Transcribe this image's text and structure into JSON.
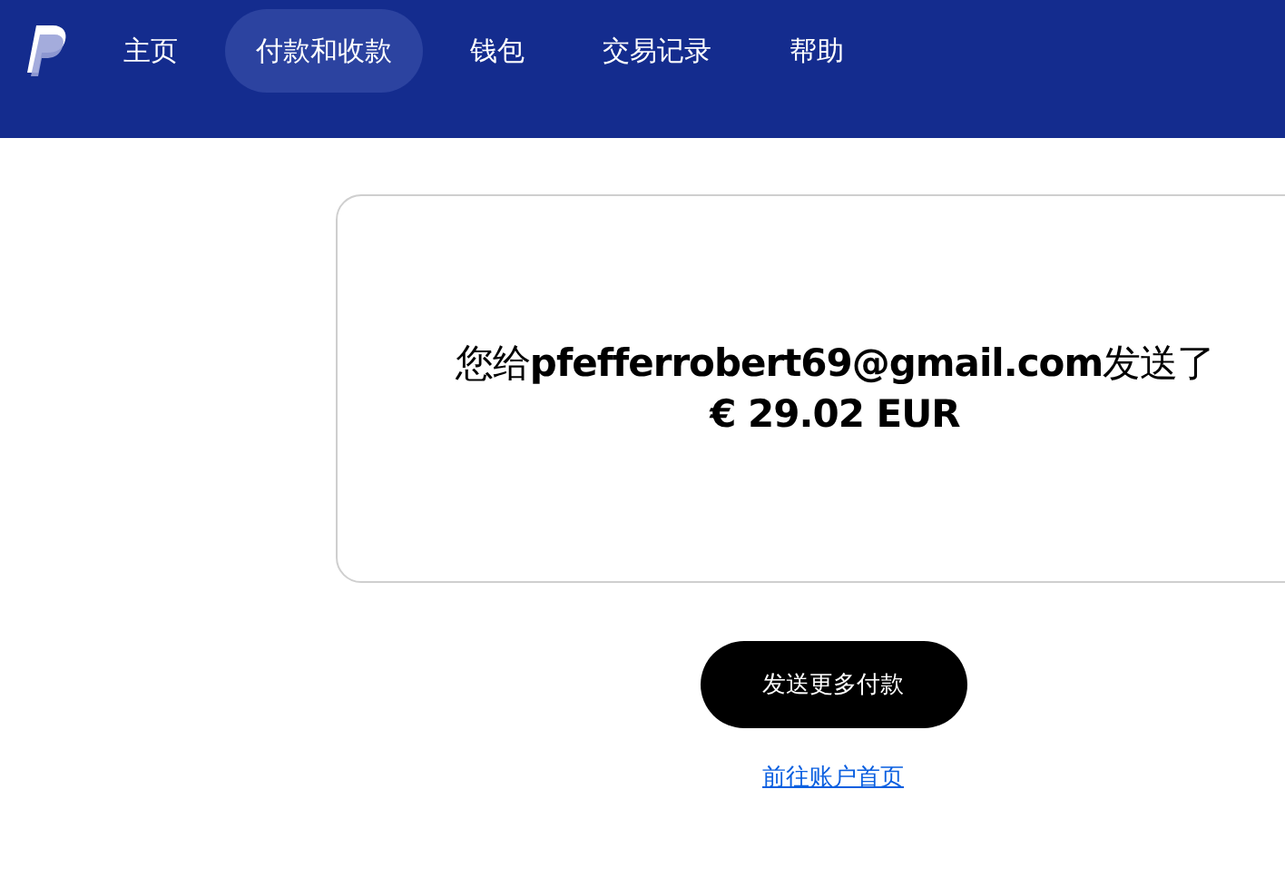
{
  "nav": {
    "items": [
      {
        "label": "主页",
        "selected": false
      },
      {
        "label": "付款和收款",
        "selected": true
      },
      {
        "label": "钱包",
        "selected": false
      },
      {
        "label": "交易记录",
        "selected": false
      },
      {
        "label": "帮助",
        "selected": false
      }
    ]
  },
  "confirmation": {
    "message": "您给**pfefferrobert69@gmail.com**发送了",
    "amount": "€ 29.02 EUR"
  },
  "send_more_button": "发送更多付款",
  "account_home_link": "前往账户首页"
}
